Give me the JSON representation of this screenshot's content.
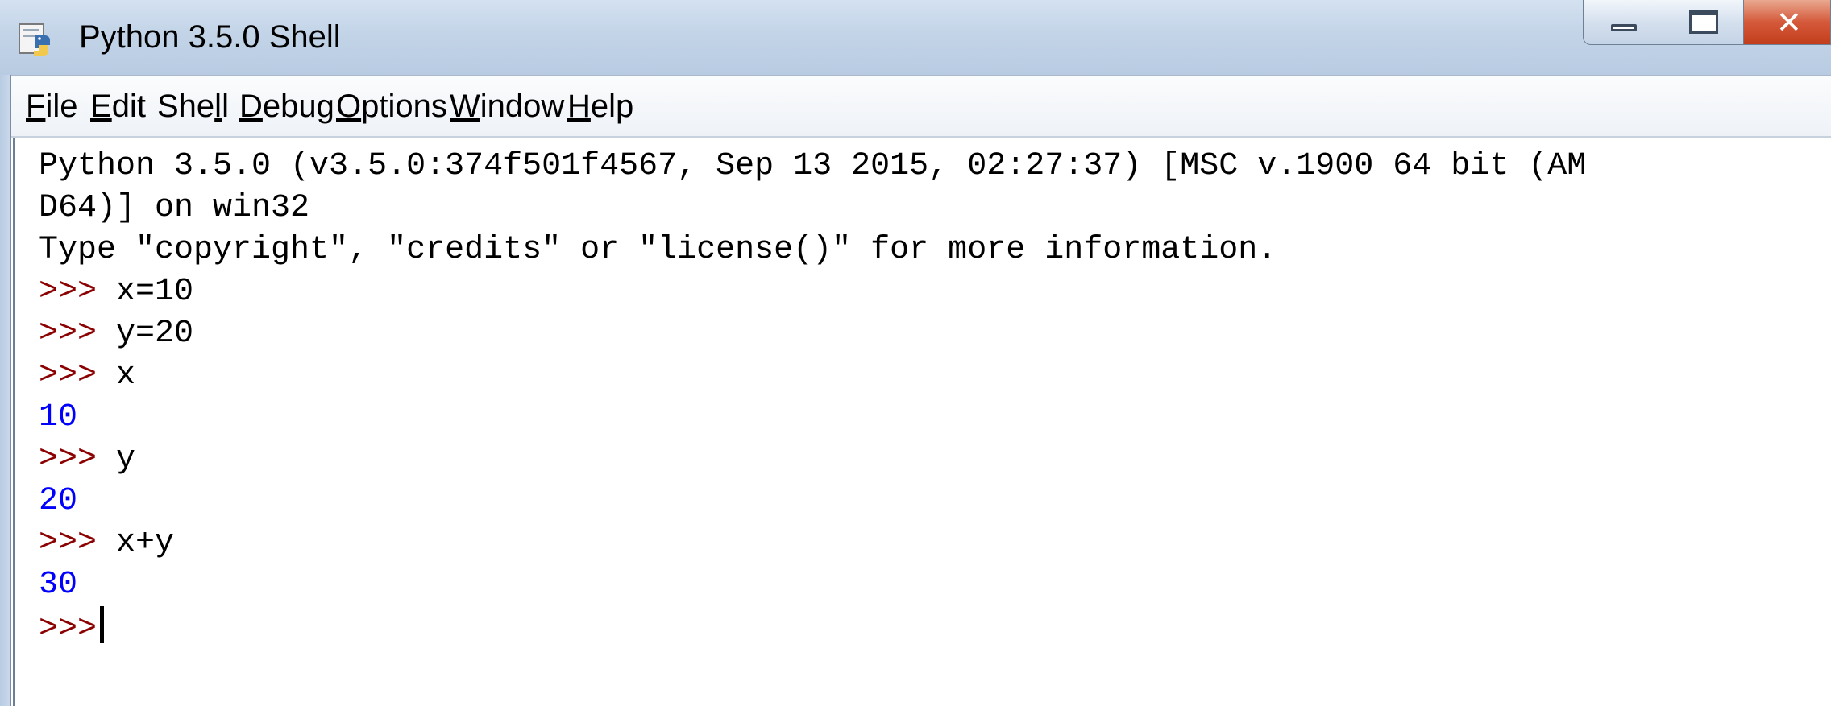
{
  "window": {
    "title": "Python 3.5.0 Shell",
    "icon": "python-idle-icon",
    "controls": {
      "minimize_icon": "minimize-icon",
      "maximize_icon": "maximize-icon",
      "close_icon": "close-icon"
    }
  },
  "menu": [
    {
      "pre": "",
      "u": "F",
      "post": "ile"
    },
    {
      "pre": "",
      "u": "E",
      "post": "dit"
    },
    {
      "pre": "She",
      "u": "l",
      "post": "l"
    },
    {
      "pre": "",
      "u": "D",
      "post": "ebug"
    },
    {
      "pre": "",
      "u": "O",
      "post": "ptions"
    },
    {
      "pre": "",
      "u": "W",
      "post": "indow"
    },
    {
      "pre": "",
      "u": "H",
      "post": "elp"
    }
  ],
  "shell": {
    "banner1": "Python 3.5.0 (v3.5.0:374f501f4567, Sep 13 2015, 02:27:37) [MSC v.1900 64 bit (AM",
    "banner2": "D64)] on win32",
    "banner3": "Type \"copyright\", \"credits\" or \"license()\" for more information.",
    "prompt": ">>>",
    "cmd1": "x=10",
    "cmd2": "y=20",
    "cmd3": "x",
    "out3": "10",
    "cmd4": "y",
    "out4": "20",
    "cmd5": "x+y",
    "out5": "30"
  },
  "colors": {
    "prompt": "#8b0000",
    "output": "#0000ff",
    "input": "#000000"
  }
}
